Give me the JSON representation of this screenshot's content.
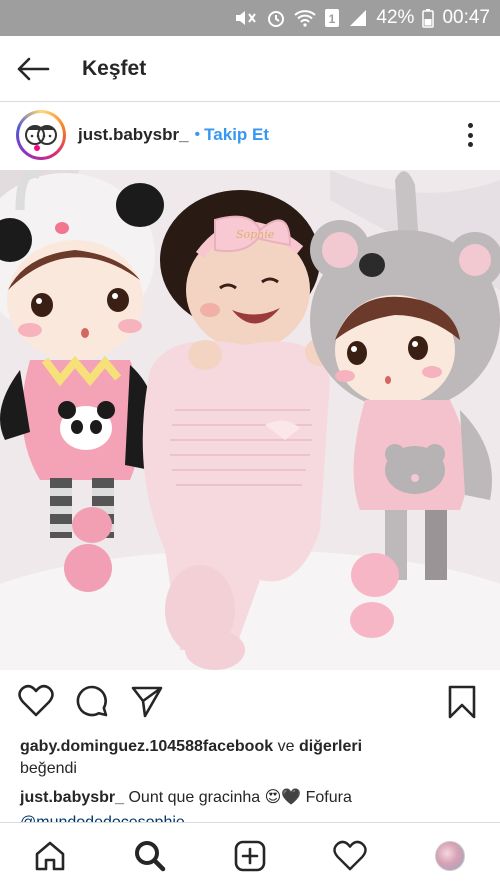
{
  "status_bar": {
    "battery": "42%",
    "time": "00:47",
    "sim_label": "1"
  },
  "header": {
    "title": "Keşfet"
  },
  "post": {
    "username": "just.babysbr_",
    "dot": "•",
    "follow_label": "Takip Et"
  },
  "likes": {
    "liker": "gaby.dominguez.104588facebook",
    "connector": "ve",
    "others": "diğerleri",
    "liked_text": "beğendi"
  },
  "caption": {
    "username": "just.babysbr_",
    "text": "Ount que gracinha 😍🖤 Fofura"
  },
  "mention": {
    "text": "@mundodedocesophie"
  },
  "icons": {
    "back": "arrow-left-icon",
    "more": "more-vertical-icon",
    "like": "heart-icon",
    "comment": "comment-icon",
    "share": "direct-share-icon",
    "save": "bookmark-icon",
    "home": "home-icon",
    "search": "search-icon",
    "add": "add-post-icon",
    "activity": "heart-icon"
  },
  "colors": {
    "status_bar": "#9e9e9e",
    "link_blue": "#3897f0",
    "text": "#262626"
  }
}
